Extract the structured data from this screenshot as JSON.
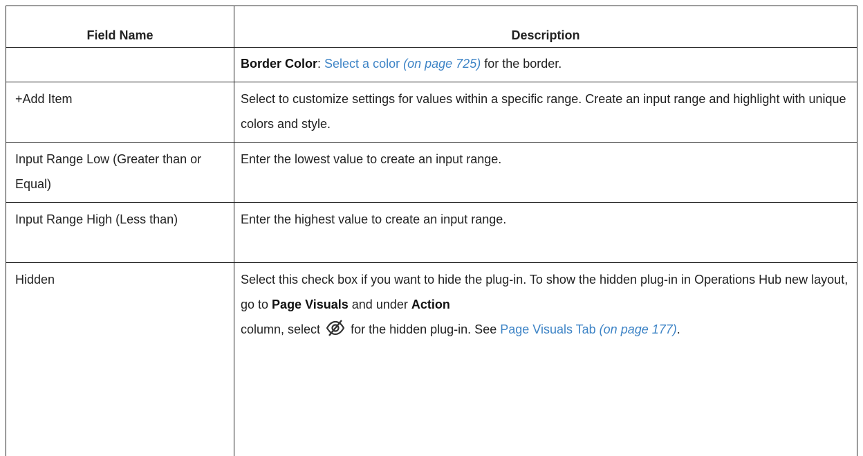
{
  "headers": {
    "field_name": "Field Name",
    "description": "Description"
  },
  "rows": [
    {
      "field": "",
      "border_color_label": "Border Color",
      "border_color_sep": ": ",
      "border_color_link": "Select a color",
      "border_color_page": "(on page 725)",
      "border_color_tail": " for the border."
    },
    {
      "field": "+Add Item",
      "description": "Select to customize settings for values within a specific range. Create an input range and highlight with unique colors and style."
    },
    {
      "field": "Input Range Low (Greater than or Equal)",
      "description": "Enter the lowest value to create an input range."
    },
    {
      "field": "Input Range High (Less than)",
      "description": "Enter the highest value to create an input range."
    },
    {
      "field": "Hidden",
      "desc_part1": "Select this check box if you want to hide the plug-in. To show the hidden plug-in in Operations Hub new layout, go to ",
      "page_visuals": "Page Visuals",
      "desc_part2": " and under ",
      "action": "Action",
      "desc_part3": " column, select",
      "desc_part4": "for the hidden plug-in. See ",
      "link_text": "Page Visuals Tab",
      "link_page": "(on page 177)",
      "desc_end": ".",
      "icon": "eye-slash-icon"
    }
  ],
  "colors": {
    "link": "#3e84c6",
    "border": "#222222"
  }
}
